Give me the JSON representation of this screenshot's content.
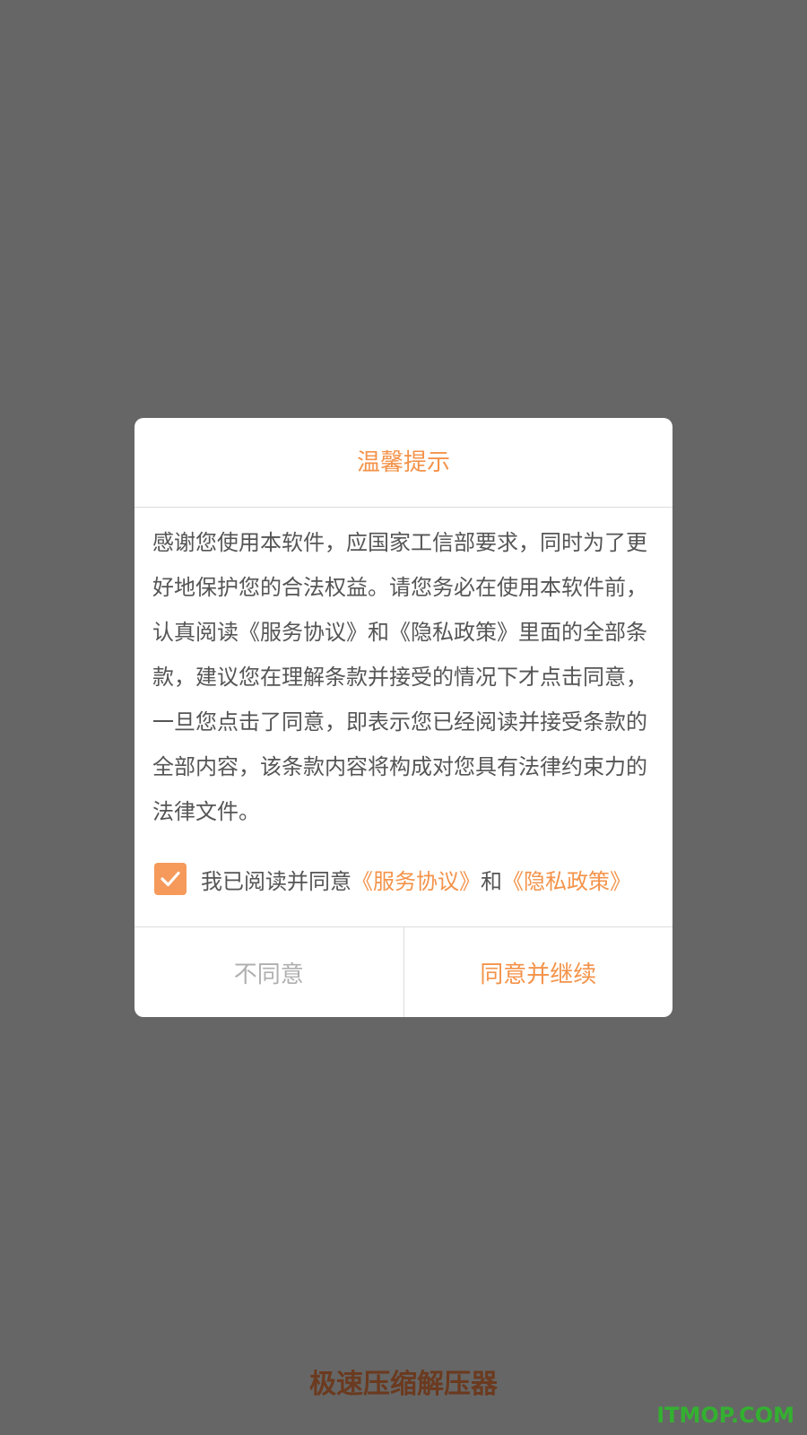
{
  "dialog": {
    "title": "温馨提示",
    "body": "感谢您使用本软件，应国家工信部要求，同时为了更好地保护您的合法权益。请您务必在使用本软件前，认真阅读《服务协议》和《隐私政策》里面的全部条款，建议您在理解条款并接受的情况下才点击同意，一旦您点击了同意，即表示您已经阅读并接受条款的全部内容，该条款内容将构成对您具有法律约束力的法律文件。",
    "checkbox_checked": true,
    "agree_prefix": "我已阅读并同意",
    "service_link": "《服务协议》",
    "and_text": "和",
    "privacy_link": "《隐私政策》",
    "disagree_label": "不同意",
    "agree_label": "同意并继续"
  },
  "app_name": "极速压缩解压器",
  "watermark": "ITMOP.COM",
  "colors": {
    "accent": "#f4934a",
    "checkbox": "#f59a5b",
    "overlay": "#666666",
    "app_name": "#6b3a1f",
    "watermark": "#34b031"
  }
}
